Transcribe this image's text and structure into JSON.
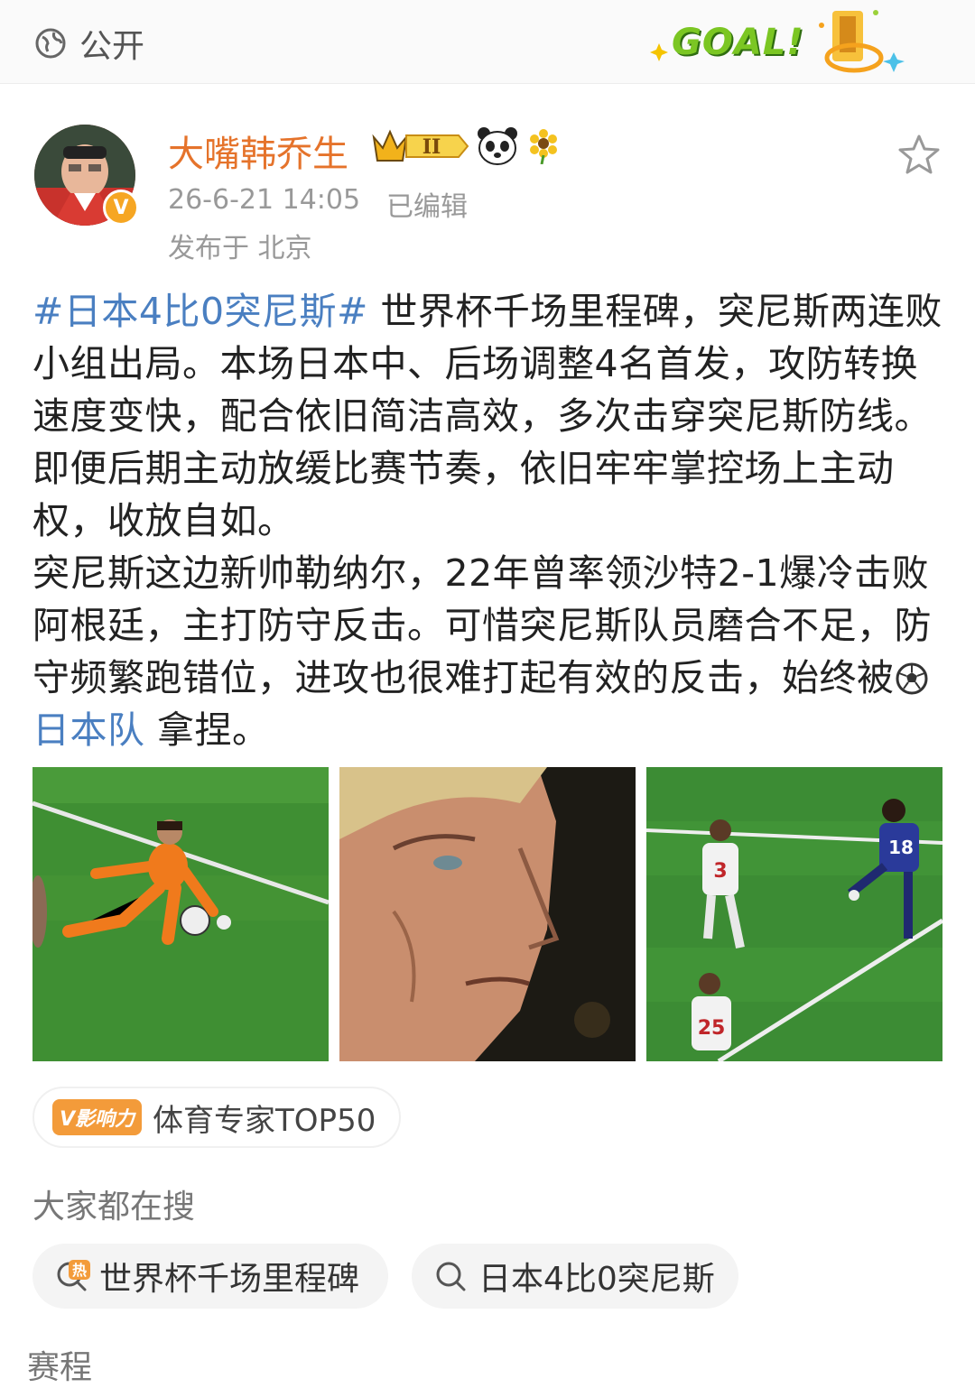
{
  "topbar": {
    "visibility_label": "公开",
    "goal_text": "GOAL!"
  },
  "author": {
    "name": "大嘴韩乔生",
    "rank_badge": "II",
    "verified_mark": "V",
    "time": "26-6-21 14:05",
    "edited": "已编辑",
    "location": "发布于 北京"
  },
  "post": {
    "hashtag": "#日本4比0突尼斯#",
    "para1_rest": " 世界杯千场里程碑，突尼斯两连败小组出局。本场日本中、后场调整4名首发，攻防转换速度变快，配合依旧简洁高效，多次击穿突尼斯防线。即便后期主动放缓比赛节奏，依旧牢牢掌控场上主动权，收放自如。",
    "para2_start": "突尼斯这边新帅勒纳尔，22年曾率领沙特2-1爆冷击败阿根廷，主打防守反击。可惜突尼斯队员磨合不足，防守频繁跑错位，进攻也很难打起有效的反击，始终被",
    "mention": "日本队",
    "para2_end": " 拿捏。"
  },
  "photos": {
    "player_numbers": [
      "3",
      "25",
      "18"
    ]
  },
  "influence": {
    "tag": "V影响力",
    "label": "体育专家TOP50"
  },
  "search": {
    "heading": "大家都在搜",
    "hot_icon_label": "热",
    "items": [
      "世界杯千场里程碑",
      "日本4比0突尼斯"
    ]
  },
  "schedule_label": "赛程",
  "colors": {
    "author_name": "#e5732b",
    "link": "#4a7fc1",
    "goal_green": "#7bc623",
    "pitch_green": "#3f8f33"
  }
}
